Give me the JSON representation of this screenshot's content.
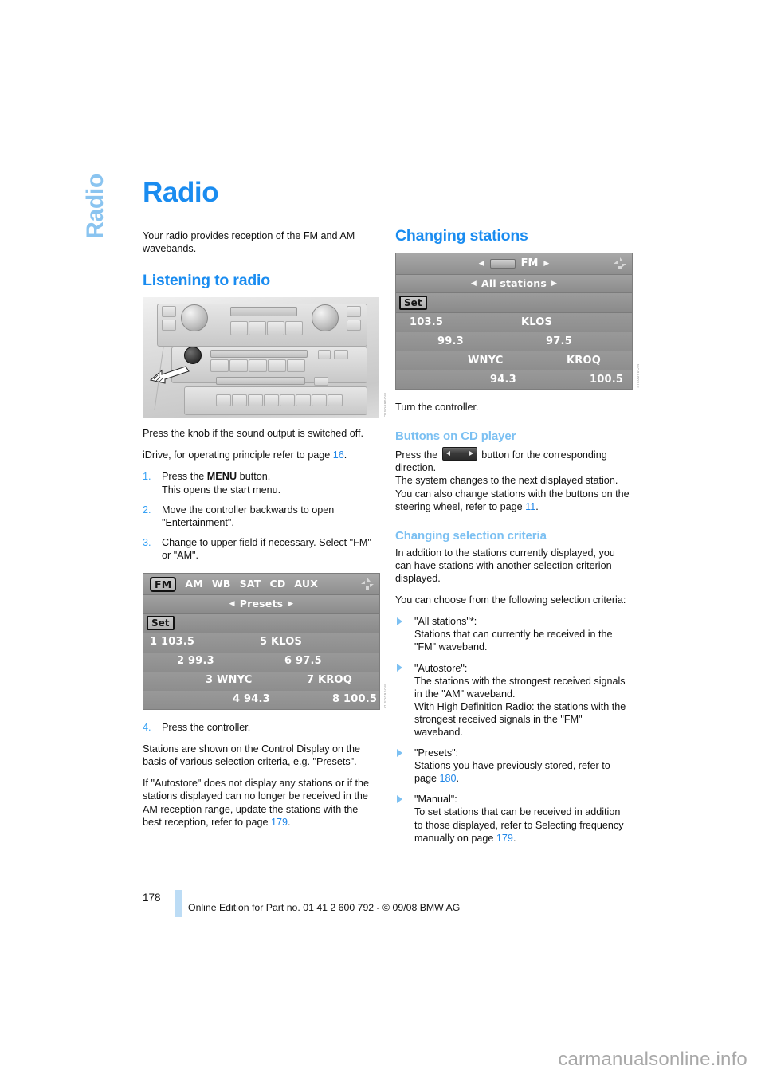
{
  "chapter_tab": "Radio",
  "page_title": "Radio",
  "left_column": {
    "intro": "Your radio provides reception of the FM and AM wavebands.",
    "section_heading": "Listening to radio",
    "console_figure": {
      "name": "audio-console-photo",
      "ref_code": "MO0600SIC"
    },
    "after_photo_1": "Press the knob if the sound output is switched off.",
    "after_photo_2_pre": "iDrive, for operating principle refer to page ",
    "after_photo_2_ref": "16",
    "after_photo_2_post": ".",
    "steps": [
      {
        "num": "1.",
        "pre": "Press the ",
        "bold": "MENU",
        "post": " button.",
        "line2": "This opens the start menu."
      },
      {
        "num": "2.",
        "pre": "Move the controller backwards to open \"Entertainment\".",
        "bold": "",
        "post": "",
        "line2": ""
      },
      {
        "num": "3.",
        "pre": "Change to upper field if necessary. Select \"FM\" or \"AM\".",
        "bold": "",
        "post": "",
        "line2": ""
      }
    ],
    "presets_display": {
      "name": "presets-control-display",
      "ref_code": "MO0600SID",
      "tabs": [
        "FM",
        "AM",
        "WB",
        "SAT",
        "CD",
        "AUX"
      ],
      "selected_tab": "FM",
      "band_label": "Presets",
      "set_label": "Set",
      "rows": [
        {
          "left": "1 103.5",
          "right": "5 KLOS"
        },
        {
          "left": "2 99.3",
          "right": "6 97.5"
        },
        {
          "left": "3 WNYC",
          "right": "7 KROQ"
        },
        {
          "left": "4 94.3",
          "right": "8 100.5"
        }
      ]
    },
    "step4": {
      "num": "4.",
      "text": "Press the controller."
    },
    "para_stations": "Stations are shown on the Control Display on the basis of various selection criteria, e.g. \"Presets\".",
    "para_autostore_pre": "If \"Autostore\" does not display any stations or if the stations displayed can no longer be received in the AM reception range, update the stations with the best reception, refer to page ",
    "para_autostore_ref": "179",
    "para_autostore_post": "."
  },
  "right_column": {
    "section_heading_1": "Changing stations",
    "stations_display": {
      "name": "all-stations-control-display",
      "ref_code": "MO0600SIE",
      "band_label": "FM",
      "criteria_label": "All stations",
      "set_label": "Set",
      "rows": [
        {
          "left": "103.5",
          "right": "KLOS"
        },
        {
          "left": "99.3",
          "right": "97.5"
        },
        {
          "left": "WNYC",
          "right": "KROQ"
        },
        {
          "left": "94.3",
          "right": "100.5"
        }
      ]
    },
    "turn_controller": "Turn the controller.",
    "sub_heading_1": "Buttons on CD player",
    "cd_press_pre": "Press the ",
    "cd_press_post": " button for the corresponding direction.",
    "cd_line2": "The system changes to the next displayed station.",
    "cd_line3_pre": "You can also change stations with the buttons on the steering wheel, refer to page ",
    "cd_line3_ref": "11",
    "cd_line3_post": ".",
    "sub_heading_2": "Changing selection criteria",
    "criteria_p1": "In addition to the stations currently displayed, you can have stations with another selection criterion displayed.",
    "criteria_p2": "You can choose from the following selection criteria:",
    "bullets": [
      {
        "title": "\"All stations\"*:",
        "body": "Stations that can currently be received in the \"FM\" waveband.",
        "body2": "",
        "ref": "",
        "ref_post": ""
      },
      {
        "title": "\"Autostore\":",
        "body": "The stations with the strongest received signals in the \"AM\" waveband.",
        "body2": "With High Definition Radio: the stations with the strongest received signals in the \"FM\" waveband.",
        "ref": "",
        "ref_post": ""
      },
      {
        "title": "\"Presets\":",
        "body": "Stations you have previously stored, refer to page ",
        "body2": "",
        "ref": "180",
        "ref_post": "."
      },
      {
        "title": "\"Manual\":",
        "body": "To set stations that can be received in addition to those displayed, refer to Selecting frequency manually on page ",
        "body2": "",
        "ref": "179",
        "ref_post": "."
      }
    ]
  },
  "footer": {
    "page_number": "178",
    "edition_text": "Online Edition for Part no. 01 41 2 600 792 - © 09/08 BMW AG"
  },
  "watermark": "carmanualsonline.info",
  "colors": {
    "heading_blue": "#1a8cf0",
    "sub_heading_blue": "#7cc0f2",
    "tab_blue": "#8ac4f0",
    "page_ref_blue": "#1f86e8",
    "footer_bar": "#bcdcf5"
  }
}
